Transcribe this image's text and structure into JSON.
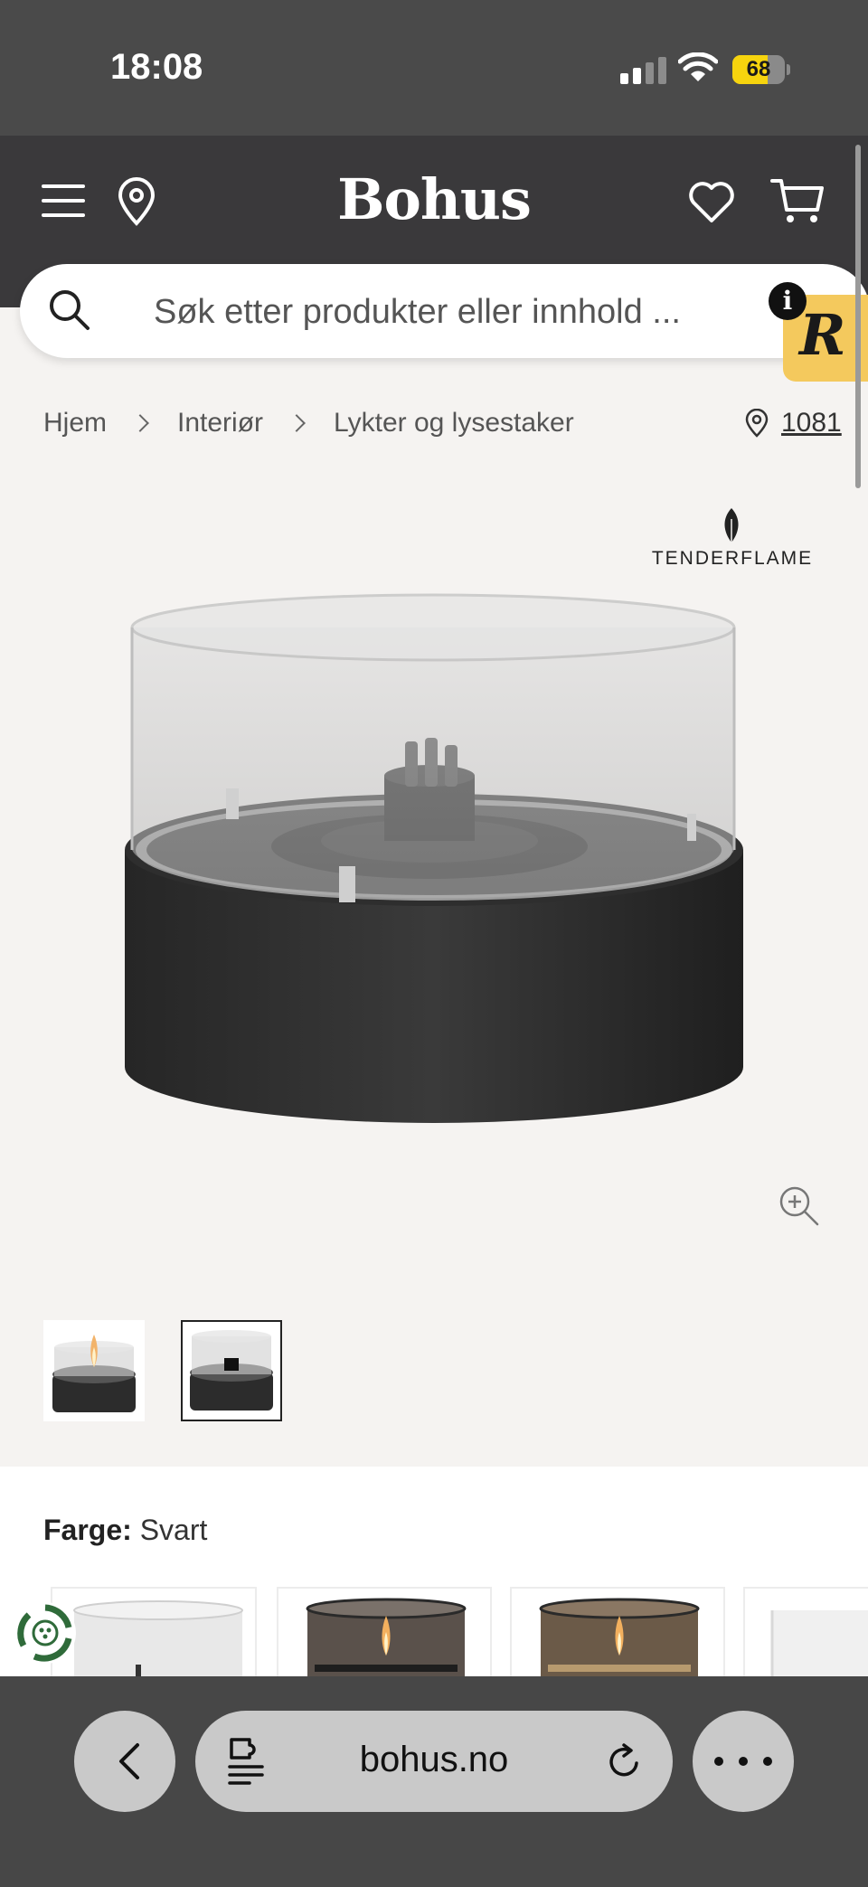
{
  "status_bar": {
    "time": "18:08",
    "battery_level": "68",
    "battery_fraction": 0.68,
    "battery_color": "#f6d40e"
  },
  "header": {
    "logo": "Bohus",
    "icons": [
      "menu-icon",
      "location-icon",
      "heart-icon",
      "cart-icon"
    ],
    "background": "#3a393b"
  },
  "search": {
    "placeholder": "Søk etter produkter eller innhold ..."
  },
  "badges": {
    "info": "i",
    "r_badge": "R",
    "r_badge_color": "#f4c95d"
  },
  "breadcrumb": {
    "items": [
      "Hjem",
      "Interiør",
      "Lykter og lysestaker"
    ],
    "store_code": "1081"
  },
  "product": {
    "brand": "TENDERFLAME",
    "thumbnails": [
      "thumbnail-lit",
      "thumbnail-unlit"
    ],
    "selected_thumbnail": 2
  },
  "options": {
    "color_label": "Farge:",
    "color_value": "Svart"
  },
  "browser": {
    "url": "bohus.no"
  }
}
